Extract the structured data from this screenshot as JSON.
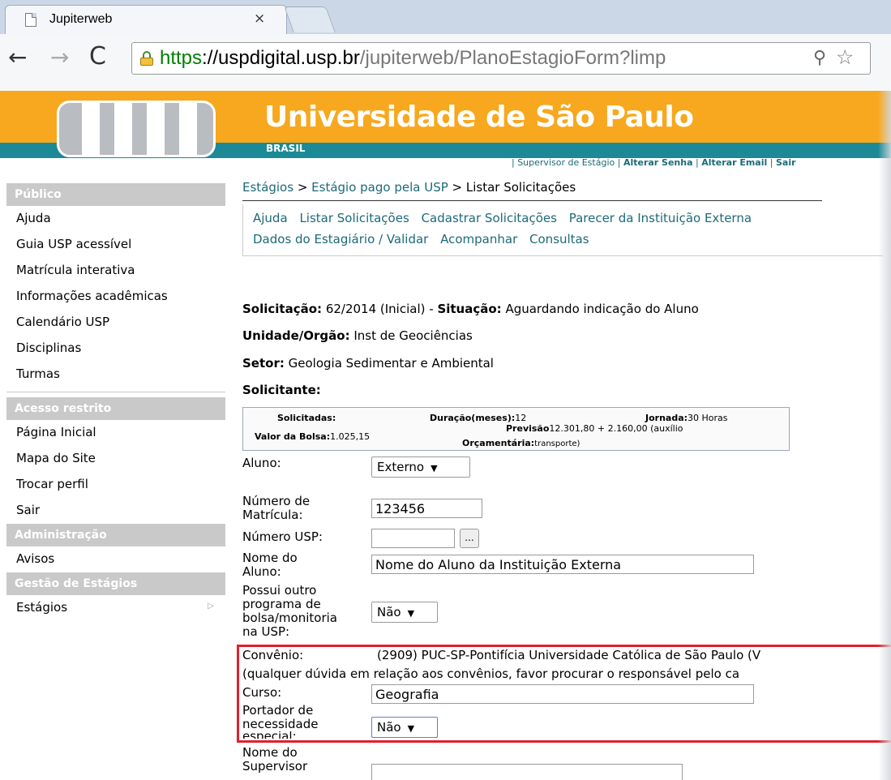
{
  "browser": {
    "tab_title": "Jupiterweb",
    "tab_close": "×",
    "url_scheme": "https",
    "url_host": "://uspdigital.usp.br",
    "url_path": "/jupiterweb/PlanoEstagioForm?limp",
    "back": "←",
    "forward": "→",
    "reload": "C",
    "zoom_icon": "⚲",
    "star_icon": "☆"
  },
  "header": {
    "title": "Universidade de São Paulo",
    "subtitle": "BRASIL",
    "links_prefix": "| Supervisor de Estágio | ",
    "link_senha": "Alterar Senha",
    "sep1": " | ",
    "link_email": "Alterar Email",
    "sep2": " | ",
    "link_sair": "Sair"
  },
  "sidebar": {
    "publico_title": "Público",
    "publico_items": [
      "Ajuda",
      "Guia USP acessível",
      "Matrícula interativa",
      "Informações acadêmicas",
      "Calendário USP",
      "Disciplinas",
      "Turmas"
    ],
    "restrito_title": "Acesso restrito",
    "restrito_items": [
      "Página Inicial",
      "Mapa do Site",
      "Trocar perfil",
      "Sair"
    ],
    "admin_title": "Administração",
    "admin_items": [
      "Avisos"
    ],
    "gestao_title": "Gestão de Estágios",
    "gestao_items": [
      "Estágios"
    ]
  },
  "breadcrumb": {
    "a": "Estágios",
    "sep1": " > ",
    "b": "Estágio pago pela USP",
    "sep2": " > ",
    "c": "Listar Solicitações"
  },
  "menu": {
    "items_row1": [
      "Ajuda",
      "Listar Solicitações",
      "Cadastrar Solicitações",
      "Parecer da Instituição Externa"
    ],
    "items_row2": [
      "Dados do Estagiário / Validar",
      "Acompanhar",
      "Consultas"
    ]
  },
  "solicitacao": {
    "label": "Solicitação:",
    "value": " 62/2014 (Inicial) - ",
    "situacao_label": "Situação:",
    "situacao_value": " Aguardando indicação do Aluno",
    "unidade_label": "Unidade/Orgão:",
    "unidade_value": " Inst de Geociências",
    "setor_label": "Setor:",
    "setor_value": " Geologia Sedimentar e Ambiental",
    "solicitante_label": "Solicitante:"
  },
  "summary": {
    "solicitadas_label": "Solicitadas:",
    "duracao_label": "Duração(meses):",
    "duracao_value": "12",
    "jornada_label": "Jornada:",
    "jornada_value": "30 Horas",
    "valor_label": "Valor da Bolsa:",
    "valor_value": "1.025,15",
    "previsao_label": "Previsão",
    "previsao_value": "12.301,80 + 2.160,00 (auxílio",
    "orcamentaria_label": "Orçamentária:",
    "orcamentaria_value": "transporte)"
  },
  "form": {
    "aluno_label": "Aluno:",
    "aluno_value": "Externo",
    "matricula_label_1": "Número de",
    "matricula_label_2": "Matrícula:",
    "matricula_value": "123456",
    "nusp_label": "Número USP:",
    "nusp_value": "",
    "nusp_button": "...",
    "nome_label_1": "Nome do",
    "nome_label_2": "Aluno:",
    "nome_value": "Nome do Aluno da Instituição Externa",
    "outro_label_1": "Possui outro",
    "outro_label_2": "programa de",
    "outro_label_3": "bolsa/monitoria",
    "outro_label_4": "na USP:",
    "outro_value": "Não",
    "convenio_label": "Convênio:",
    "convenio_value": "(2909) PUC-SP-Pontifícia Universidade Católica de São Paulo (V",
    "convenio_note": "(qualquer dúvida em relação aos convênios, favor procurar o responsável pelo ca",
    "curso_label": "Curso:",
    "curso_value": "Geografia",
    "portador_label_1": "Portador de",
    "portador_label_2": "necessidade",
    "portador_label_3": "especial:",
    "portador_value": "Não",
    "supervisor_label_1": "Nome do",
    "supervisor_label_2": "Supervisor",
    "supervisor_value": ""
  },
  "colors": {
    "banner_orange": "#f7a81e",
    "banner_teal": "#1c8a96",
    "link": "#1c6a78",
    "highlight_box": "#e0202b",
    "sidebar_header": "#c9c9c9"
  }
}
